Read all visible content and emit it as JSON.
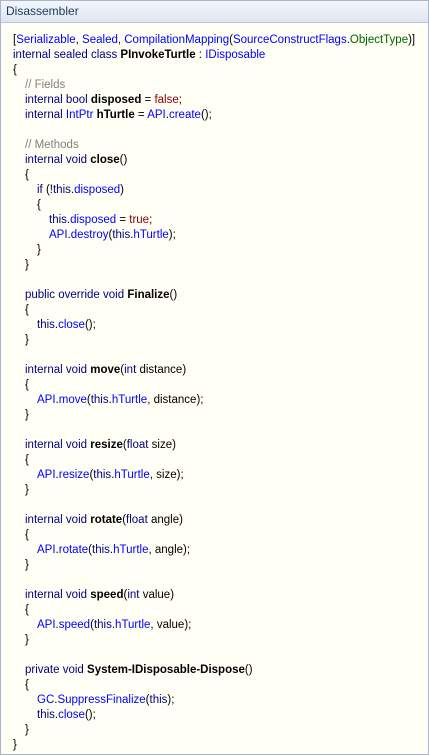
{
  "window": {
    "title": "Disassembler"
  },
  "code": {
    "attr_open": "[",
    "attr_serializable": "Serializable",
    "attr_sep": ", ",
    "attr_sealed": "Sealed",
    "attr_compmap": "CompilationMapping",
    "attr_paren": "(",
    "attr_scf": "SourceConstructFlags",
    "attr_dot": ".",
    "attr_objtype": "ObjectType",
    "attr_close": ")]",
    "class_mods": "internal sealed class ",
    "class_name": "PInvokeTurtle",
    "class_colon": " : ",
    "class_iface": "IDisposable",
    "brace_open": "{",
    "brace_close": "}",
    "comment_fields": "// Fields",
    "comment_methods": "// Methods",
    "kw_internal": "internal",
    "kw_public": "public",
    "kw_private": "private",
    "kw_override": "override",
    "kw_if": "if",
    "kw_this": "this",
    "t_bool": "bool",
    "t_intptr": "IntPtr",
    "t_void": "void",
    "t_int": "int",
    "t_float": "float",
    "v_false": "false",
    "v_true": "true",
    "sp": " ",
    "eq": " = ",
    "semi": ";",
    "call_semi": "();",
    "paren_open": "(",
    "paren_close": ")",
    "dot": ".",
    "comma": ", ",
    "close_semi": ");",
    "not_open": "(!",
    "parens": "()",
    "f_disposed": "disposed",
    "f_hturtle": "hTurtle",
    "api": "API",
    "m_create": "create",
    "m_destroy": "destroy",
    "m_close": "close",
    "m_finalize": "Finalize",
    "m_move": "move",
    "p_distance": "distance",
    "m_resize": "resize",
    "p_size": "size",
    "m_rotate": "rotate",
    "p_angle": "angle",
    "m_speed": "speed",
    "p_value": "value",
    "m_dispose": "System-IDisposable-Dispose",
    "gc": "GC",
    "m_suppress": "SuppressFinalize"
  }
}
